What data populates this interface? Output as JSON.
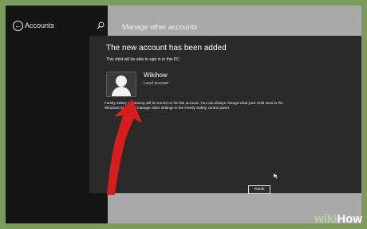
{
  "left_pane": {
    "title": "Accounts",
    "back_icon": "back-arrow-icon",
    "search_icon": "search-icon"
  },
  "right_pane": {
    "title": "Manage other accounts"
  },
  "dialog": {
    "title": "The new account has been added",
    "subtitle": "This child will be able to sign in to this PC.",
    "user": {
      "name": "Wikihow",
      "type": "Local account"
    },
    "notice": "Family Safety monitoring will be turned on for this account. You can always change what your child sees in the Windows Store and manage other settings in the Family Safety control panel.",
    "finish_label": "Finish"
  },
  "watermark": {
    "part1": "wiki",
    "part2": "How"
  },
  "colors": {
    "outer_border": "#7a9b5c",
    "screen_bg": "#a9a9a9",
    "left_pane": "#141414",
    "dialog": "#2a2a2a",
    "arrow": "#d51e1e"
  }
}
